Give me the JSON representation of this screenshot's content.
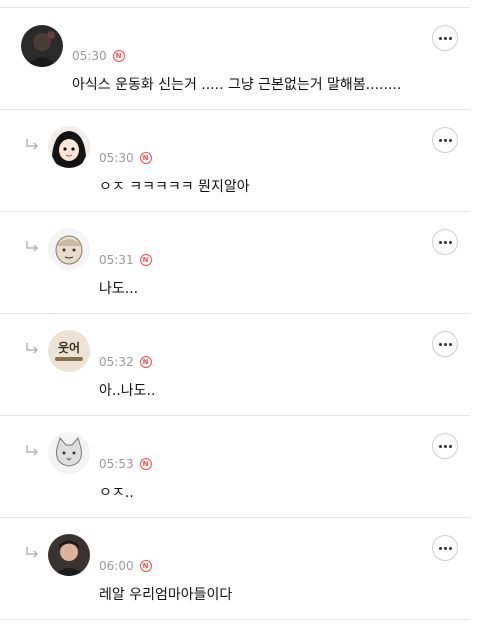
{
  "comments": [
    {
      "time": "05:30",
      "badge": "N",
      "text": "아식스 운동화 신는거 ..... 그냥 근본없는거 말해봄........",
      "is_reply": false,
      "avatar": "dark-photo-avatar-icon"
    },
    {
      "time": "05:30",
      "badge": "N",
      "text": "ㅇㅈ ㅋㅋㅋㅋㅋ 뭔지알아",
      "is_reply": true,
      "avatar": "anime-girl-avatar-icon"
    },
    {
      "time": "05:31",
      "badge": "N",
      "text": "나도...",
      "is_reply": true,
      "avatar": "cartoon-face-avatar-icon"
    },
    {
      "time": "05:32",
      "badge": "N",
      "text": "아..나도..",
      "is_reply": true,
      "avatar": "text-sticker-avatar-icon",
      "avatar_text": "웃어"
    },
    {
      "time": "05:53",
      "badge": "N",
      "text": "ㅇㅈ..",
      "is_reply": true,
      "avatar": "cat-sketch-avatar-icon"
    },
    {
      "time": "06:00",
      "badge": "N",
      "text": "레알 우리엄마아들이다",
      "is_reply": true,
      "avatar": "person-photo-avatar-icon"
    }
  ],
  "colors": {
    "badge": "#ff4b4b",
    "meta_text": "#9a9a9a",
    "divider": "#e6e6e6"
  }
}
